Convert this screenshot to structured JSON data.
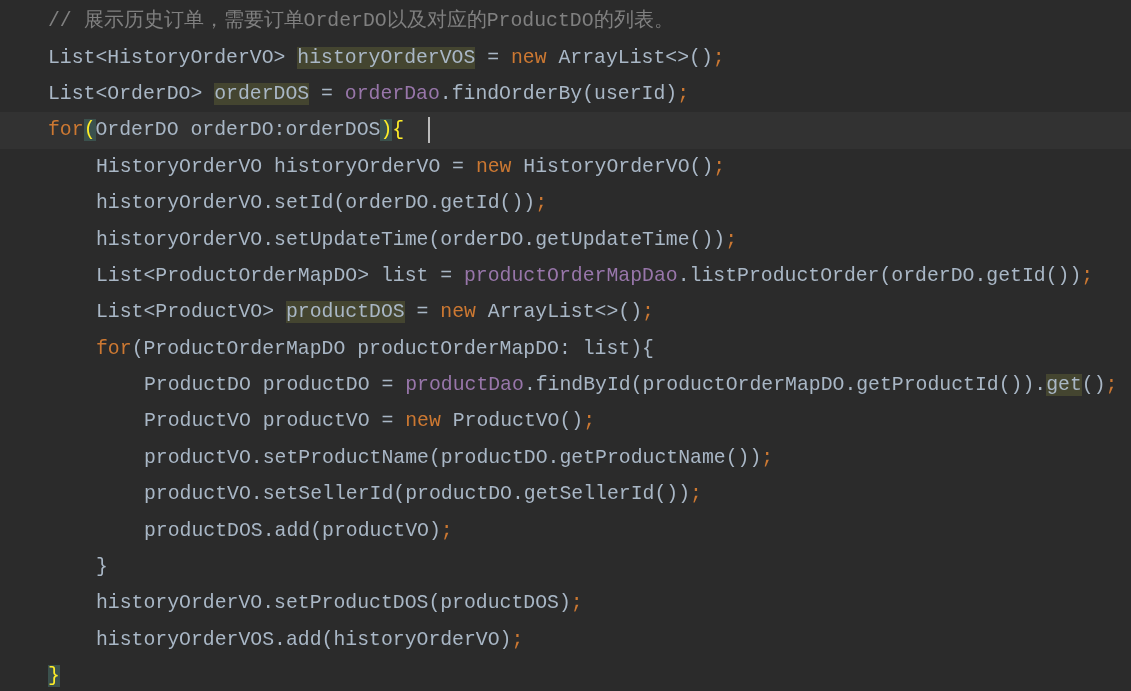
{
  "editor": {
    "lines": [
      {
        "tokens": [
          {
            "t": "// 展示历史订单，需要订单OrderDO以及对应的ProductDO的列表。",
            "kind": "comment"
          }
        ]
      },
      {
        "tokens": [
          {
            "t": "List<HistoryOrderVO> ",
            "kind": "plain"
          },
          {
            "t": "historyOrderVOS",
            "kind": "usage"
          },
          {
            "t": " = ",
            "kind": "plain"
          },
          {
            "t": "new",
            "kind": "keyword"
          },
          {
            "t": " ArrayList<>()",
            "kind": "plain"
          },
          {
            "t": ";",
            "kind": "keyword"
          }
        ]
      },
      {
        "tokens": [
          {
            "t": "List<OrderDO> ",
            "kind": "plain"
          },
          {
            "t": "orderDOS",
            "kind": "usage"
          },
          {
            "t": " = ",
            "kind": "plain"
          },
          {
            "t": "orderDao",
            "kind": "field"
          },
          {
            "t": ".findOrderBy(userId)",
            "kind": "plain"
          },
          {
            "t": ";",
            "kind": "keyword"
          }
        ]
      },
      {
        "current": true,
        "tokens": [
          {
            "t": "for",
            "kind": "keyword"
          },
          {
            "t": "(",
            "kind": "brace"
          },
          {
            "t": "OrderDO orderDO:orderDOS",
            "kind": "plain"
          },
          {
            "t": ")",
            "kind": "brace"
          },
          {
            "t": "{",
            "kind": "match"
          }
        ],
        "children": [
          {
            "tokens": [
              {
                "t": "HistoryOrderVO historyOrderVO = ",
                "kind": "plain"
              },
              {
                "t": "new",
                "kind": "keyword"
              },
              {
                "t": " HistoryOrderVO()",
                "kind": "plain"
              },
              {
                "t": ";",
                "kind": "keyword"
              }
            ]
          },
          {
            "tokens": [
              {
                "t": "historyOrderVO.setId(orderDO.getId())",
                "kind": "plain"
              },
              {
                "t": ";",
                "kind": "keyword"
              }
            ]
          },
          {
            "tokens": [
              {
                "t": "historyOrderVO.setUpdateTime(orderDO.getUpdateTime())",
                "kind": "plain"
              },
              {
                "t": ";",
                "kind": "keyword"
              }
            ]
          },
          {
            "tokens": [
              {
                "t": "List<ProductOrderMapDO> list = ",
                "kind": "plain"
              },
              {
                "t": "productOrderMapDao",
                "kind": "field"
              },
              {
                "t": ".listProductOrder(orderDO.getId())",
                "kind": "plain"
              },
              {
                "t": ";",
                "kind": "keyword"
              }
            ]
          },
          {
            "tokens": [
              {
                "t": "List<ProductVO> ",
                "kind": "plain"
              },
              {
                "t": "productDOS",
                "kind": "usage"
              },
              {
                "t": " = ",
                "kind": "plain"
              },
              {
                "t": "new",
                "kind": "keyword"
              },
              {
                "t": " ArrayList<>()",
                "kind": "plain"
              },
              {
                "t": ";",
                "kind": "keyword"
              }
            ]
          },
          {
            "tokens": [
              {
                "t": "for",
                "kind": "keyword"
              },
              {
                "t": "(ProductOrderMapDO productOrderMapDO: list){",
                "kind": "plain"
              }
            ],
            "children": [
              {
                "tokens": [
                  {
                    "t": "ProductDO productDO = ",
                    "kind": "plain"
                  },
                  {
                    "t": "productDao",
                    "kind": "field"
                  },
                  {
                    "t": ".findById(productOrderMapDO.getProductId()).",
                    "kind": "plain"
                  },
                  {
                    "t": "get",
                    "kind": "usage"
                  },
                  {
                    "t": "()",
                    "kind": "plain"
                  },
                  {
                    "t": ";",
                    "kind": "keyword"
                  }
                ]
              },
              {
                "tokens": [
                  {
                    "t": "ProductVO productVO = ",
                    "kind": "plain"
                  },
                  {
                    "t": "new",
                    "kind": "keyword"
                  },
                  {
                    "t": " ProductVO()",
                    "kind": "plain"
                  },
                  {
                    "t": ";",
                    "kind": "keyword"
                  }
                ]
              },
              {
                "tokens": [
                  {
                    "t": "productVO.setProductName(productDO.getProductName())",
                    "kind": "plain"
                  },
                  {
                    "t": ";",
                    "kind": "keyword"
                  }
                ]
              },
              {
                "tokens": [
                  {
                    "t": "productVO.setSellerId(productDO.getSellerId())",
                    "kind": "plain"
                  },
                  {
                    "t": ";",
                    "kind": "keyword"
                  }
                ]
              },
              {
                "tokens": [
                  {
                    "t": "productDOS.add(productVO)",
                    "kind": "plain"
                  },
                  {
                    "t": ";",
                    "kind": "keyword"
                  }
                ]
              }
            ]
          },
          {
            "tokens": [
              {
                "t": "}",
                "kind": "plain"
              }
            ]
          },
          {
            "tokens": [
              {
                "t": "historyOrderVO.setProductDOS(productDOS)",
                "kind": "plain"
              },
              {
                "t": ";",
                "kind": "keyword"
              }
            ]
          },
          {
            "tokens": [
              {
                "t": "historyOrderVOS.add(historyOrderVO)",
                "kind": "plain"
              },
              {
                "t": ";",
                "kind": "keyword"
              }
            ]
          }
        ]
      },
      {
        "tokens": [
          {
            "t": "}",
            "kind": "brace"
          }
        ]
      }
    ]
  }
}
